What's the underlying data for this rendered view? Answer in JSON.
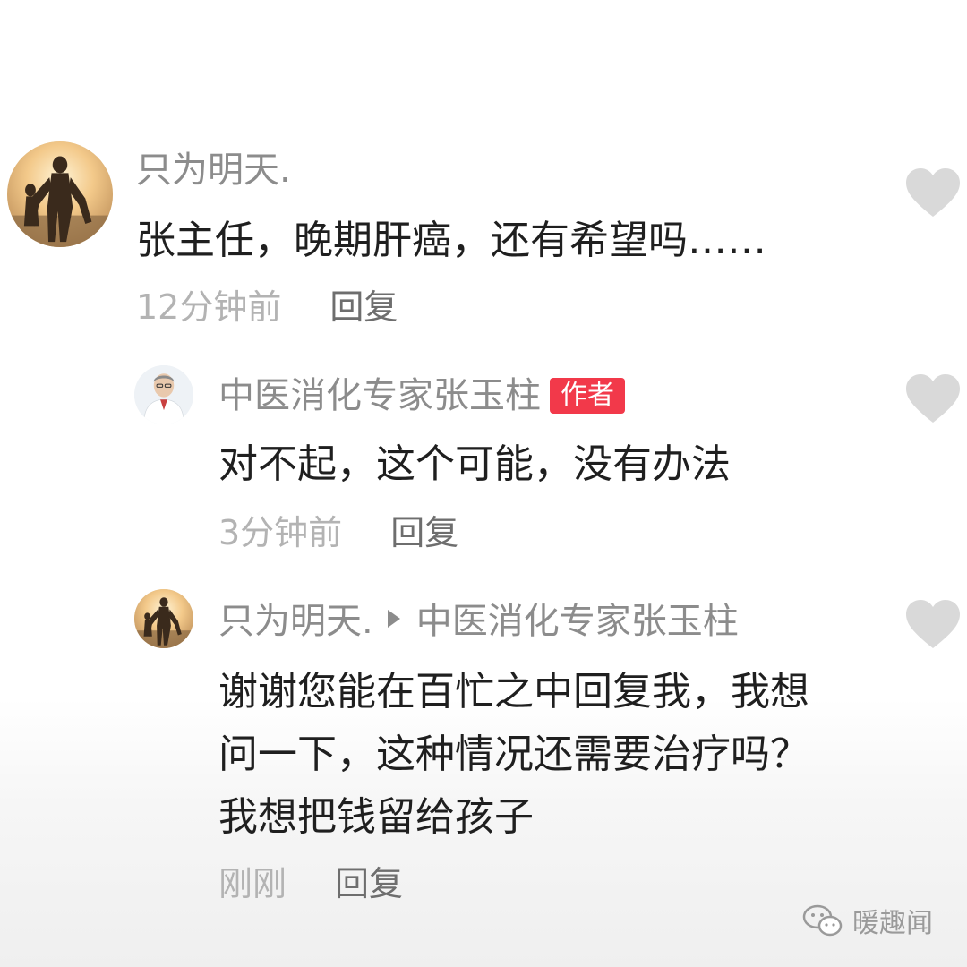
{
  "comments": [
    {
      "username": "只为明天.",
      "text_lines": [
        "张主任，晚期肝癌，还有希望吗……"
      ],
      "time": "12分钟前",
      "reply_label": "回复",
      "avatar_icon": "silhouette-sunset-avatar"
    },
    {
      "username": "中医消化专家张玉柱",
      "badge": "作者",
      "text_lines": [
        "对不起，这个可能，没有办法"
      ],
      "time": "3分钟前",
      "reply_label": "回复",
      "avatar_icon": "doctor-avatar"
    },
    {
      "username": "只为明天.",
      "reply_to": "中医消化专家张玉柱",
      "text_lines": [
        "谢谢您能在百忙之中回复我，我想",
        "问一下，这种情况还需要治疗吗？",
        "我想把钱留给孩子"
      ],
      "time": "刚刚",
      "reply_label": "回复",
      "avatar_icon": "silhouette-sunset-avatar"
    }
  ],
  "watermark": {
    "text": "暖趣闻",
    "icon": "wechat-icon"
  },
  "colors": {
    "badge": "#f2394a",
    "username": "#8c8c8c",
    "meta": "#b3b3b3",
    "heart": "#d9d9d9"
  }
}
